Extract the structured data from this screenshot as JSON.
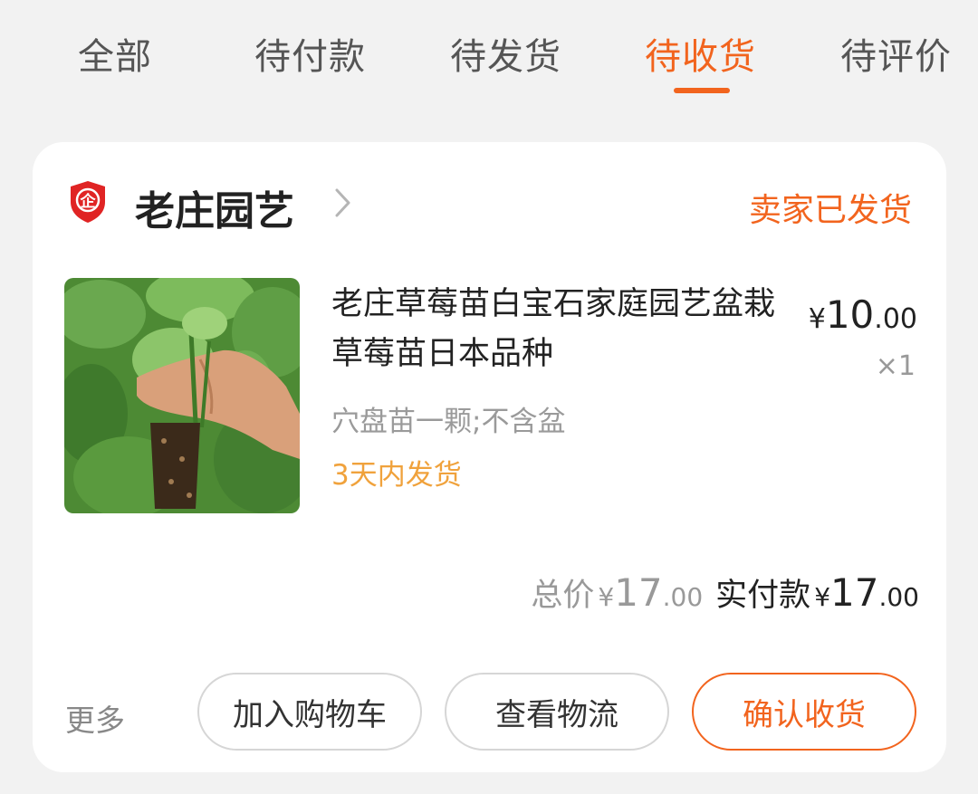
{
  "tabs": [
    {
      "label": "全部"
    },
    {
      "label": "待付款"
    },
    {
      "label": "待发货"
    },
    {
      "label": "待收货",
      "active": true
    },
    {
      "label": "待评价"
    }
  ],
  "order": {
    "shop": {
      "badge_icon": "enterprise-shield-icon",
      "badge_char": "企",
      "name": "老庄园艺"
    },
    "status": "卖家已发货",
    "item": {
      "title": "老庄草莓苗白宝石家庭园艺盆栽草莓苗日本品种",
      "price_symbol": "¥",
      "price_int": "10",
      "price_dec": ".00",
      "quantity": "×1",
      "sku": "穴盘苗一颗;不含盆",
      "shipping_promise": "3天内发货",
      "image_alt": "strawberry seedling photo"
    },
    "totals": {
      "total_label": "总价",
      "total_symbol": "¥",
      "total_int": "17",
      "total_dec": ".00",
      "paid_label": "实付款",
      "paid_symbol": "¥",
      "paid_int": "17",
      "paid_dec": ".00"
    },
    "actions": {
      "more": "更多",
      "add_to_cart": "加入购物车",
      "view_logistics": "查看物流",
      "confirm_receipt": "确认收货"
    }
  },
  "colors": {
    "accent": "#f2641e",
    "promise": "#f0a23c",
    "background": "#f2f2f2",
    "badge_red": "#e02424"
  }
}
